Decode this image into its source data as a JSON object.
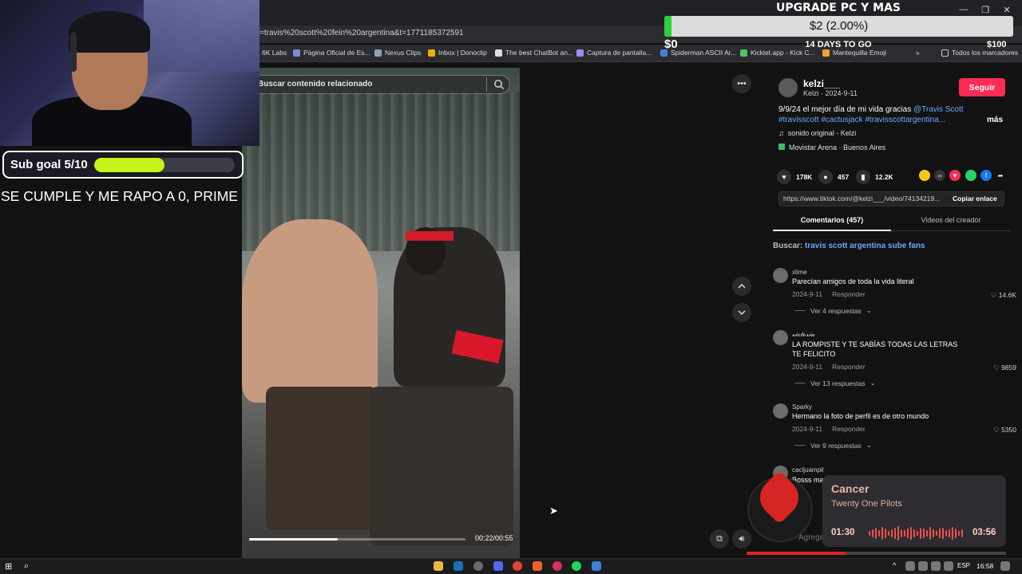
{
  "browser": {
    "url": "=travis%20scott%20fein%20argentina&t=1771185372591",
    "bookmarks": [
      "6K Labs",
      "Página Oficial de Es...",
      "Nexus Clips",
      "Inbox | Donoclip",
      "The best ChatBot an...",
      "Captura de pantalla...",
      "Spiderman ASCII Ar...",
      "Kicklet.app - Kick C...",
      "Mantequilla Emoji"
    ],
    "bookmarks_more": "»",
    "all_bookmarks": "Todos los marcadores",
    "window_controls": [
      "—",
      "❐",
      "✕"
    ]
  },
  "stream_overlay": {
    "sub_goal_label": "Sub goal 5/10",
    "sub_goal_fraction": 0.5,
    "sub_goal_note": "SE CUMPLE Y ME RAPO A 0, PRIME",
    "upgrade_title": "UPGRADE PC Y MAS",
    "upgrade_amount": "$2 (2.00%)",
    "upgrade_fraction": 0.02,
    "upgrade_min": "$0",
    "upgrade_max": "$100",
    "upgrade_days": "14 DAYS TO GO"
  },
  "video": {
    "search_placeholder": "Buscar contenido relacionado",
    "time": "00:22/00:55",
    "progress_fraction": 0.41
  },
  "post": {
    "username": "kelzi___",
    "user_line": "Kelzi · 2024-9-11",
    "follow_label": "Seguir",
    "desc_line1_prefix": "9/9/24 el mejor día de mi vida gracias ",
    "desc_mention": "@Travis Scott",
    "desc_line2": "#travisscott #cactusjack #travisscottargentina...",
    "more_label": "más",
    "sound": "sonido original - Kelzi",
    "location": "Movistar Arena · Buenos Aires",
    "likes": "178K",
    "comments": "457",
    "saves": "12.2K",
    "link": "https://www.tiktok.com/@kelzi___/video/74134219...",
    "copy_label": "Copiar enlace",
    "tab_comments": "Comentarios (457)",
    "tab_videos": "Videos del creador",
    "search_prefix": "Buscar: ",
    "search_query": "travis scott argentina sube fans"
  },
  "comments": [
    {
      "user": "xlime",
      "text": "Parecían amigos de toda la vida literal",
      "date": "2024-9-11",
      "reply": "Responder",
      "likes": "14.6K",
      "replies": "Ver 4 respuestas"
    },
    {
      "user": "𝓿𝓲𝓬𝓽𝓸𝓻𝓲𝓪",
      "text": "LA ROMPISTE Y TE SABÍAS TODAS LAS LETRAS TE FELICITO",
      "date": "2024-9-11",
      "reply": "Responder",
      "likes": "9859",
      "replies": "Ver 13 respuestas"
    },
    {
      "user": "Sparky",
      "text": "Hermano la foto de perfil es de otro mundo",
      "date": "2024-9-11",
      "reply": "Responder",
      "likes": "5350",
      "replies": "Ver 9 respuestas"
    },
    {
      "user": "cacljuampil",
      "text": "Bosss ma",
      "date": "",
      "reply": "",
      "likes": "",
      "replies": ""
    }
  ],
  "comment_input_placeholder": "Agregar",
  "music": {
    "title": "Cancer",
    "artist": "Twenty One Pilots",
    "elapsed": "01:30",
    "total": "03:56",
    "progress_fraction": 0.38
  },
  "taskbar": {
    "lang": "ESP",
    "time": "16:58"
  },
  "colors": {
    "accent": "#fe2c55",
    "link": "#6fa8ff",
    "goal_fill": "#c6f31a",
    "upgrade_fill": "#2bd138",
    "music_accent": "#e52020"
  }
}
